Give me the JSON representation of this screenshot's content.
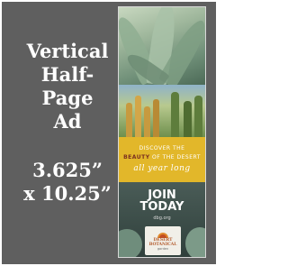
{
  "spec": {
    "title_lines": [
      "Vertical",
      "Half-",
      "Page",
      "Ad"
    ],
    "size_lines": [
      "3.625”",
      "x 10.25”"
    ]
  },
  "ad": {
    "tagline": {
      "line1": "DISCOVER THE",
      "line2_emphasis": "BEAUTY",
      "line2_rest": "OF",
      "line3": "THE DESERT",
      "script": "all year long"
    },
    "cta": {
      "line1": "JOIN",
      "line2": "TODAY",
      "url": "dbg.org"
    },
    "logo": {
      "line1": "DESERT",
      "line2": "BOTANICAL",
      "line3": "garden"
    },
    "colors": {
      "panel": "#5f5f5f",
      "yellow_band": "#e2b72a",
      "beauty_word": "#7a2f20",
      "cta_band": "#2f3f3b"
    }
  }
}
